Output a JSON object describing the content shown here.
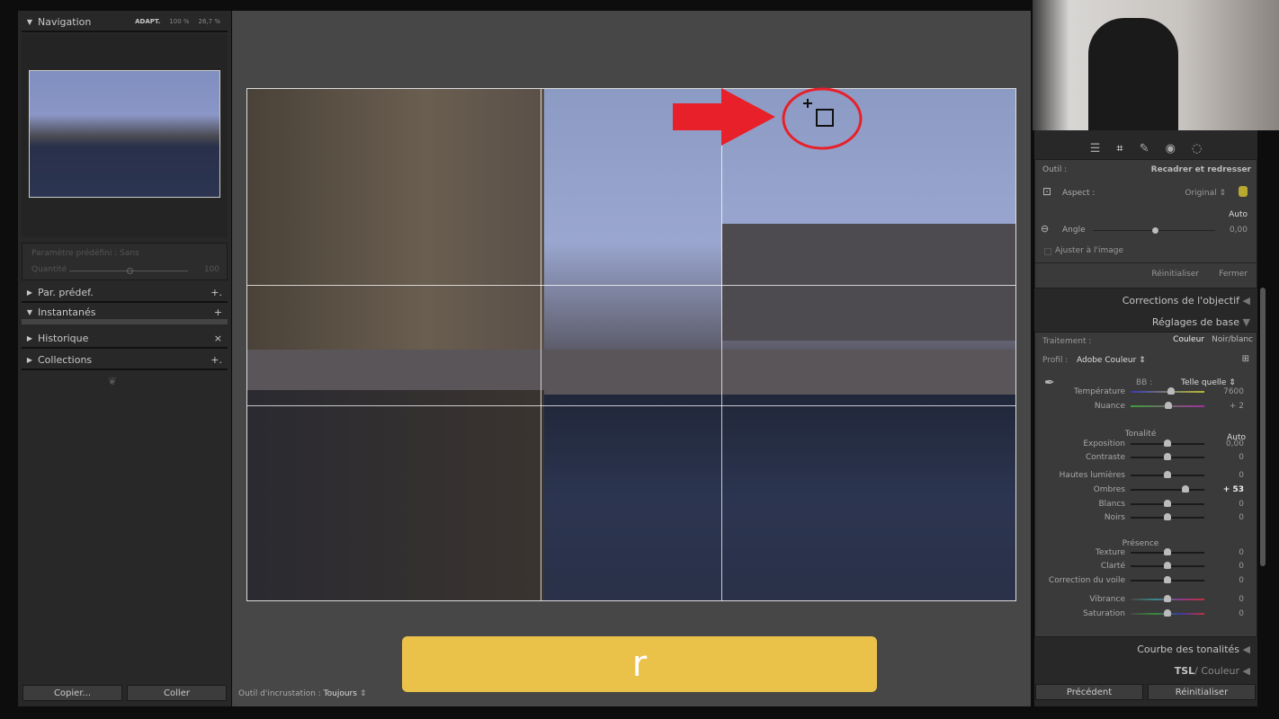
{
  "navigation": {
    "title": "Navigation",
    "zoom_options": [
      "ADAPT.",
      "100 %",
      "26,7 %"
    ]
  },
  "preset_box": {
    "label": "Paramètre prédéfini : Sans",
    "amount_label": "Quantité",
    "amount_value": "100",
    "amount_fraction": 0.5
  },
  "left_panels": [
    {
      "label": "Par. prédef.",
      "expanded": false,
      "action": "+."
    },
    {
      "label": "Instantanés",
      "expanded": true,
      "action": "+"
    },
    {
      "label": "Historique",
      "expanded": false,
      "action": "×"
    },
    {
      "label": "Collections",
      "expanded": false,
      "action": "+."
    }
  ],
  "left_buttons": {
    "copy": "Copier...",
    "paste": "Coller"
  },
  "toolbar": {
    "overlay_label": "Outil d'incrustation :",
    "overlay_value": "Toujours"
  },
  "key_overlay": {
    "text": "r",
    "color": "#eac24a"
  },
  "annotation_color": "#e8202a",
  "crop": {
    "tool_label": "Outil :",
    "tool_name": "Recadrer et redresser",
    "aspect_label": "Aspect :",
    "aspect_value": "Original",
    "auto": "Auto",
    "angle_label": "Angle",
    "angle_value": "0,00",
    "angle_fraction": 0.5,
    "fit_label": "Ajuster à l'image",
    "fit_checked": false,
    "reset": "Réinitialiser",
    "close": "Fermer"
  },
  "panels": {
    "lens": "Corrections de l'objectif",
    "basic": "Réglages de base",
    "tone_curve": "Courbe des tonalités",
    "hsl": "TSL",
    "hsl_sub": "/ Couleur"
  },
  "basic": {
    "treatment_label": "Traitement :",
    "color": "Couleur",
    "bw": "Noir/blanc",
    "profile_label": "Profil :",
    "profile_value": "Adobe Couleur",
    "wb_label": "BB :",
    "wb_value": "Telle quelle",
    "tone_label": "Tonalité",
    "tone_auto": "Auto",
    "presence_label": "Présence",
    "sliders": [
      {
        "label": "Température",
        "value": "7600",
        "fraction": 0.55
      },
      {
        "label": "Nuance",
        "value": "+ 2",
        "fraction": 0.51
      },
      {
        "label": "Exposition",
        "value": "0,00",
        "fraction": 0.5
      },
      {
        "label": "Contraste",
        "value": "0",
        "fraction": 0.5
      },
      {
        "label": "Hautes lumières",
        "value": "0",
        "fraction": 0.5
      },
      {
        "label": "Ombres",
        "value": "+ 53",
        "fraction": 0.74
      },
      {
        "label": "Blancs",
        "value": "0",
        "fraction": 0.5
      },
      {
        "label": "Noirs",
        "value": "0",
        "fraction": 0.5
      },
      {
        "label": "Texture",
        "value": "0",
        "fraction": 0.5
      },
      {
        "label": "Clarté",
        "value": "0",
        "fraction": 0.5
      },
      {
        "label": "Correction du voile",
        "value": "0",
        "fraction": 0.5
      },
      {
        "label": "Vibrance",
        "value": "0",
        "fraction": 0.5
      },
      {
        "label": "Saturation",
        "value": "0",
        "fraction": 0.5
      }
    ]
  },
  "right_buttons": {
    "previous": "Précédent",
    "reset": "Réinitialiser"
  }
}
